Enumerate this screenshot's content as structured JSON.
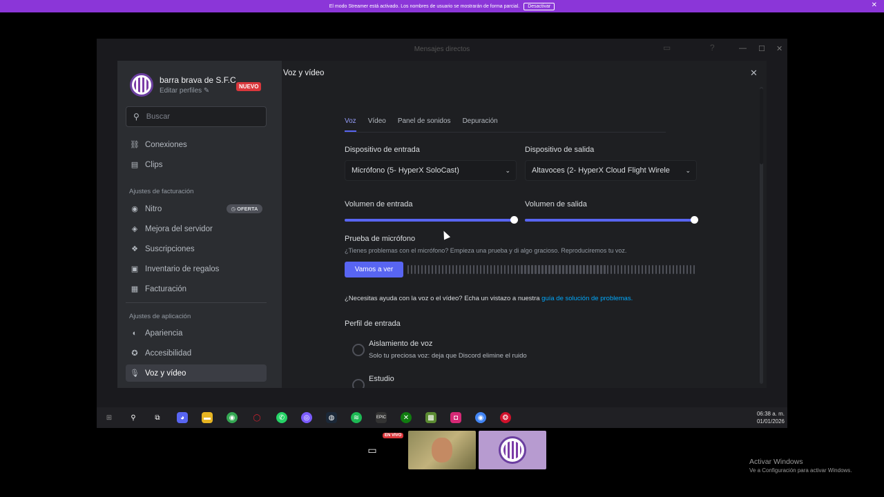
{
  "banner": {
    "text": "El modo Streamer está activado. Los nombres de usuario se mostrarán de forma parcial.",
    "button": "Desactivar",
    "close": "✕"
  },
  "background_window": {
    "title": "Mensajes directos"
  },
  "profile": {
    "name": "barra brava de S.F.C",
    "edit": "Editar perfiles",
    "badge": "NUEVO"
  },
  "search": {
    "placeholder": "Buscar"
  },
  "sidebar": {
    "items_top": [
      {
        "label": "Conexiones",
        "icon": "link-icon"
      },
      {
        "label": "Clips",
        "icon": "clips-icon"
      }
    ],
    "billing_header": "Ajustes de facturación",
    "billing_items": [
      {
        "label": "Nitro",
        "icon": "nitro-icon",
        "badge": "OFERTA"
      },
      {
        "label": "Mejora del servidor",
        "icon": "boost-icon"
      },
      {
        "label": "Suscripciones",
        "icon": "subscriptions-icon"
      },
      {
        "label": "Inventario de regalos",
        "icon": "gift-icon"
      },
      {
        "label": "Facturación",
        "icon": "billing-icon"
      }
    ],
    "app_header": "Ajustes de aplicación",
    "app_items": [
      {
        "label": "Apariencia",
        "icon": "palette-icon"
      },
      {
        "label": "Accesibilidad",
        "icon": "accessibility-icon"
      },
      {
        "label": "Voz y vídeo",
        "icon": "microphone-icon",
        "active": true
      }
    ]
  },
  "modal": {
    "title": "Voz y vídeo",
    "tabs": [
      "Voz",
      "Vídeo",
      "Panel de sonidos",
      "Depuración"
    ],
    "input_device_label": "Dispositivo de entrada",
    "input_device_value": "Micrófono (5- HyperX SoloCast)",
    "output_device_label": "Dispositivo de salida",
    "output_device_value": "Altavoces (2- HyperX Cloud Flight Wirele",
    "input_volume_label": "Volumen de entrada",
    "input_volume_pct": 100,
    "output_volume_label": "Volumen de salida",
    "output_volume_pct": 100,
    "mic_test_title": "Prueba de micrófono",
    "mic_test_desc": "¿Tienes problemas con el micrófono? Empieza una prueba y di algo gracioso. Reproduciremos tu voz.",
    "mic_test_button": "Vamos a ver",
    "help_text": "¿Necesitas ayuda con la voz o el vídeo? Echa un vistazo a nuestra ",
    "help_link": "guía de solución de problemas.",
    "input_profile_title": "Perfil de entrada",
    "profile_options": [
      {
        "title": "Aislamiento de voz",
        "desc": "Solo tu preciosa voz: deja que Discord elimine el ruido"
      },
      {
        "title": "Estudio",
        "desc": ""
      }
    ]
  },
  "taskbar": {
    "time": "06:38 a. m.",
    "date": "01/01/2026"
  },
  "stream": {
    "live_badge": "EN VIVO"
  },
  "windows_activation": {
    "title": "Activar Windows",
    "subtitle": "Ve a Configuración para activar Windows."
  },
  "colors": {
    "accent": "#5865f2",
    "banner": "#8b36d8",
    "danger": "#da373c",
    "link": "#00a8fc"
  }
}
